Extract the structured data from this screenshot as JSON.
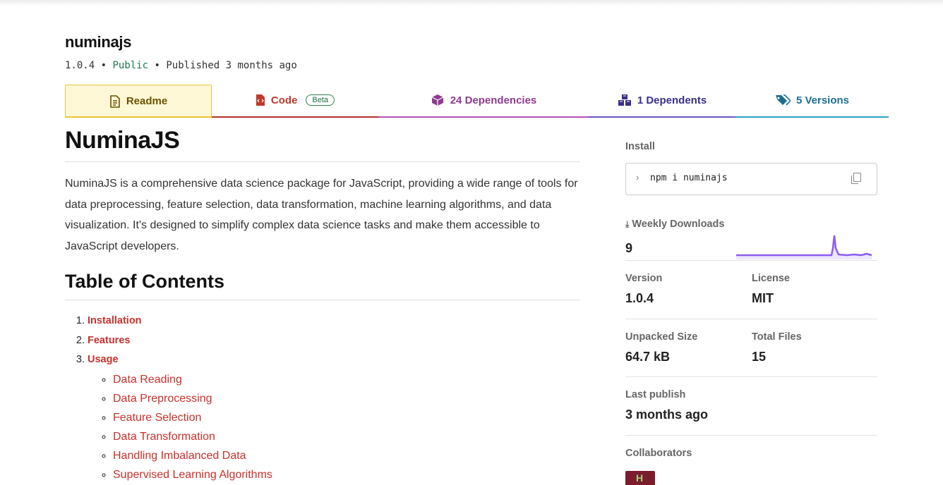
{
  "package": {
    "name": "numinajs",
    "version": "1.0.4",
    "sep1": "•",
    "visibility": "Public",
    "sep2": "•",
    "published": "Published 3 months ago"
  },
  "tabs": {
    "readme": "Readme",
    "code": "Code",
    "code_badge": "Beta",
    "dependencies": "24 Dependencies",
    "dependents": "1 Dependents",
    "versions": "5 Versions"
  },
  "readme": {
    "title": "NuminaJS",
    "intro": "NuminaJS is a comprehensive data science package for JavaScript, providing a wide range of tools for data preprocessing, feature selection, data transformation, machine learning algorithms, and data visualization. It's designed to simplify complex data science tasks and make them accessible to JavaScript developers.",
    "toc_title": "Table of Contents",
    "toc": [
      "Installation",
      "Features",
      "Usage"
    ],
    "usage_sub": [
      "Data Reading",
      "Data Preprocessing",
      "Feature Selection",
      "Data Transformation",
      "Handling Imbalanced Data",
      "Supervised Learning Algorithms"
    ]
  },
  "sidebar": {
    "install_label": "Install",
    "install_cmd": "npm i numinajs",
    "weekly_label": "Weekly Downloads",
    "weekly_value": "9",
    "version_label": "Version",
    "version_value": "1.0.4",
    "license_label": "License",
    "license_value": "MIT",
    "unpacked_label": "Unpacked Size",
    "unpacked_value": "64.7 kB",
    "files_label": "Total Files",
    "files_value": "15",
    "last_publish_label": "Last publish",
    "last_publish_value": "3 months ago",
    "collaborators_label": "Collaborators"
  },
  "colors": {
    "readme": "#6a5200",
    "code": "#c0392b",
    "dependencies": "#8e3b8e",
    "dependents": "#3a2f8a",
    "versions": "#1c6e8f",
    "sparkline": "#8b5cf6"
  },
  "icons": {
    "readme": "document-icon",
    "code": "code-file-icon",
    "dependencies": "box-icon",
    "dependents": "boxes-icon",
    "versions": "tags-icon",
    "install": "chevron-right-icon",
    "copy": "copy-icon",
    "downloads": "download-icon"
  }
}
